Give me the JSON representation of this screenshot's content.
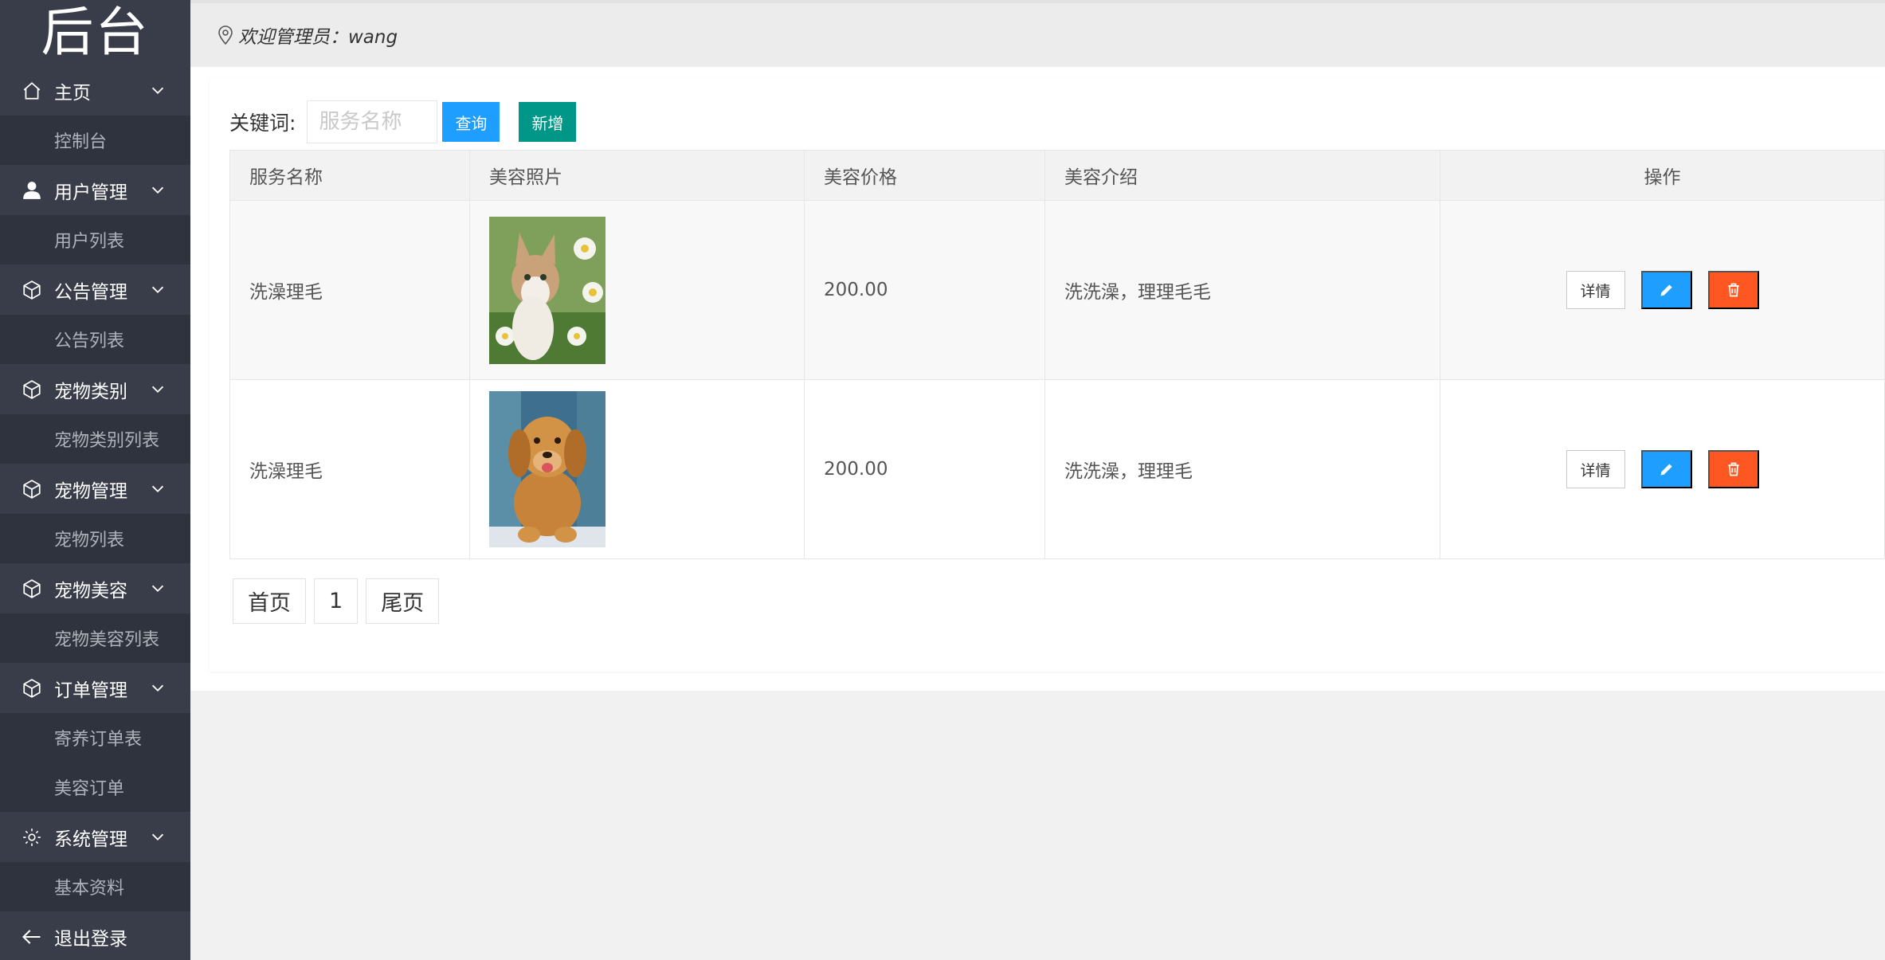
{
  "sidebar": {
    "brand": "后台",
    "sections": [
      {
        "label": "主页",
        "icon": "home-icon",
        "sub": "控制台"
      },
      {
        "label": "用户管理",
        "icon": "user-icon",
        "sub": "用户列表"
      },
      {
        "label": "公告管理",
        "icon": "cube-icon",
        "sub": "公告列表"
      },
      {
        "label": "宠物类别",
        "icon": "cube-icon",
        "sub": "宠物类别列表"
      },
      {
        "label": "宠物管理",
        "icon": "cube-icon",
        "sub": "宠物列表"
      },
      {
        "label": "宠物美容",
        "icon": "cube-icon",
        "sub": "宠物美容列表"
      },
      {
        "label": "订单管理",
        "icon": "cube-icon",
        "subs": [
          "寄养订单表",
          "美容订单"
        ]
      },
      {
        "label": "系统管理",
        "icon": "gear-icon",
        "sub": "基本资料"
      }
    ],
    "logout": "退出登录"
  },
  "topbar": {
    "welcome": "欢迎管理员：wang"
  },
  "toolbar": {
    "keyword_label": "关键词:",
    "search_placeholder": "服务名称",
    "search_value": "",
    "query_label": "查询",
    "add_label": "新增"
  },
  "table": {
    "headers": [
      "服务名称",
      "美容照片",
      "美容价格",
      "美容介绍",
      "操作"
    ],
    "rows": [
      {
        "name": "洗澡理毛",
        "photo": "cat-photo",
        "price": "200.00",
        "intro": "洗洗澡，理理毛毛",
        "detail_label": "详情"
      },
      {
        "name": "洗澡理毛",
        "photo": "dog-photo",
        "price": "200.00",
        "intro": "洗洗澡，理理毛",
        "detail_label": "详情"
      }
    ]
  },
  "pager": {
    "first": "首页",
    "current": "1",
    "last": "尾页"
  },
  "colors": {
    "sidebar_bg": "#393d49",
    "sub_bg": "#2f333d",
    "query_btn": "#1e9fff",
    "add_btn": "#009688",
    "edit_btn": "#1e9fff",
    "delete_btn": "#ff5722"
  }
}
